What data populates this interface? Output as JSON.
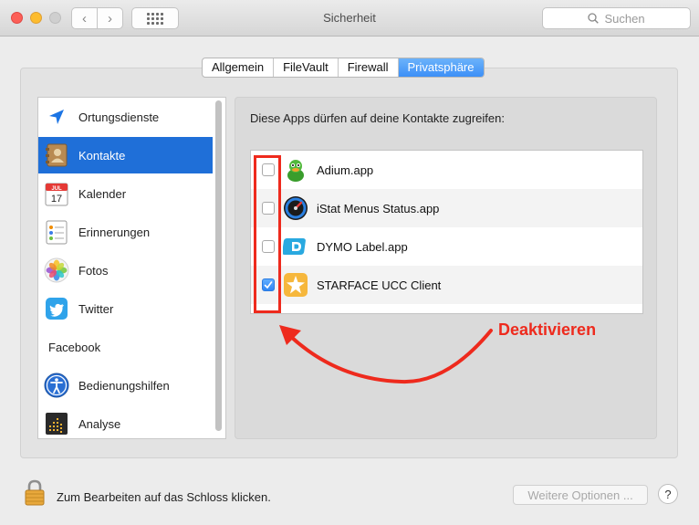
{
  "window": {
    "title": "Sicherheit",
    "search_placeholder": "Suchen"
  },
  "tabs": [
    {
      "label": "Allgemein",
      "active": false
    },
    {
      "label": "FileVault",
      "active": false
    },
    {
      "label": "Firewall",
      "active": false
    },
    {
      "label": "Privatsphäre",
      "active": true
    }
  ],
  "sidebar": {
    "items": [
      {
        "label": "Ortungsdienste",
        "icon": "location-arrow-icon",
        "selected": false
      },
      {
        "label": "Kontakte",
        "icon": "contacts-book-icon",
        "selected": true
      },
      {
        "label": "Kalender",
        "icon": "calendar-icon",
        "selected": false,
        "icon_text": {
          "month": "JUL",
          "day": "17"
        }
      },
      {
        "label": "Erinnerungen",
        "icon": "reminders-icon",
        "selected": false
      },
      {
        "label": "Fotos",
        "icon": "photos-icon",
        "selected": false
      },
      {
        "label": "Twitter",
        "icon": "twitter-icon",
        "selected": false
      },
      {
        "label": "Facebook",
        "icon": null,
        "selected": false
      },
      {
        "label": "Bedienungshilfen",
        "icon": "accessibility-icon",
        "selected": false
      },
      {
        "label": "Analyse",
        "icon": "analytics-icon",
        "selected": false
      }
    ]
  },
  "content": {
    "intro": "Diese Apps dürfen auf deine Kontakte zugreifen:",
    "apps": [
      {
        "name": "Adium.app",
        "checked": false,
        "icon": "adium-duck-icon"
      },
      {
        "name": "iStat Menus Status.app",
        "checked": false,
        "icon": "istat-gauge-icon"
      },
      {
        "name": "DYMO Label.app",
        "checked": false,
        "icon": "dymo-label-icon"
      },
      {
        "name": "STARFACE UCC Client",
        "checked": true,
        "icon": "starface-star-icon"
      }
    ]
  },
  "annotation": {
    "text": "Deaktivieren",
    "color": "#ee2a1d"
  },
  "footer": {
    "lock_text": "Zum Bearbeiten auf das Schloss klicken.",
    "more_options_label": "Weitere Optionen ...",
    "help_label": "?"
  },
  "colors": {
    "accent": "#1f6fd8",
    "checkbox_checked": "#2f86f5"
  }
}
